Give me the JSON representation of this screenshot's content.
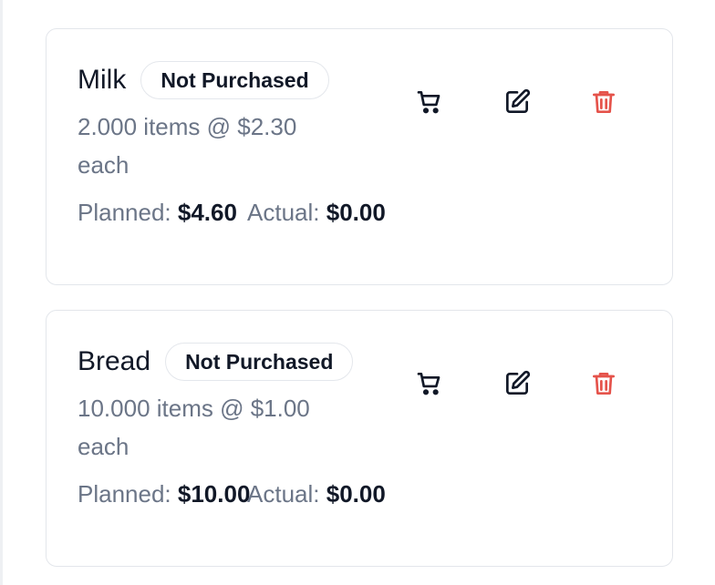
{
  "colors": {
    "text_primary": "#111827",
    "text_muted": "#6b7587",
    "delete_red": "#e5534b",
    "border": "#e3e6eb"
  },
  "items": [
    {
      "name": "Milk",
      "status": "Not Purchased",
      "quantity_text": "2.000 items @ $2.30 each",
      "planned_label": "Planned:",
      "planned_value": "$4.60",
      "actual_label": "Actual:",
      "actual_value": "$0.00",
      "icons": [
        "cart-icon",
        "edit-icon",
        "trash-icon"
      ]
    },
    {
      "name": "Bread",
      "status": "Not Purchased",
      "quantity_text": "10.000 items @ $1.00 each",
      "planned_label": "Planned:",
      "planned_value": "$10.00",
      "actual_label": "Actual:",
      "actual_value": "$0.00",
      "icons": [
        "cart-icon",
        "edit-icon",
        "trash-icon"
      ]
    }
  ]
}
